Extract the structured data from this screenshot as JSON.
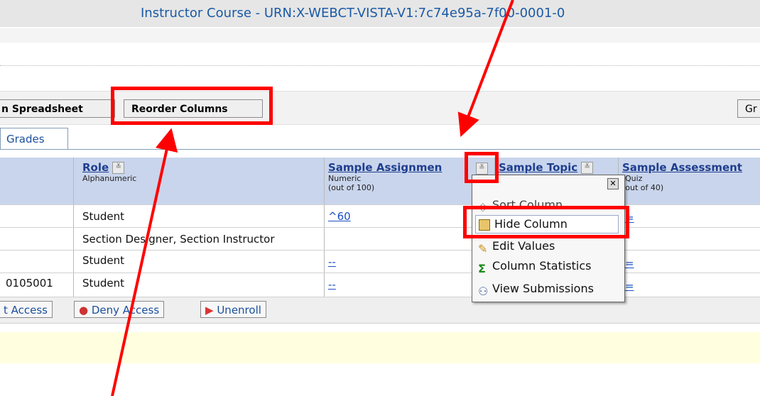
{
  "header": {
    "title": "Instructor Course - URN:X-WEBCT-VISTA-V1:7c74e95a-7f00-0001-0"
  },
  "toolbar": {
    "spreadsheet_label": "n Spreadsheet",
    "reorder_label": "Reorder Columns",
    "right_label": "Gr"
  },
  "tabs": {
    "grades_label": "Grades"
  },
  "grid": {
    "columns": {
      "role": {
        "label": "Role",
        "type": "Alphanumeric"
      },
      "assignment": {
        "label": "Sample Assignmen",
        "type": "Numeric",
        "out_of": "(out of 100)"
      },
      "topic": {
        "label": "Sample Topic"
      },
      "assessment": {
        "label": "Sample Assessment",
        "type": "Quiz",
        "out_of": "(out of 40)"
      }
    },
    "rows": [
      {
        "id": "",
        "role": "Student",
        "assignment": "^60"
      },
      {
        "id": "",
        "role": "Section Designer, Section Instructor",
        "assignment": ""
      },
      {
        "id": "",
        "role": "Student",
        "assignment": "--"
      },
      {
        "id": "0105001",
        "role": "Student",
        "assignment": "--"
      }
    ]
  },
  "context_menu": {
    "items": [
      "Sort Column",
      "Hide Column",
      "Edit Values",
      "Column Statistics",
      "View Submissions"
    ]
  },
  "bottom_actions": {
    "grant_label": "t Access",
    "deny_label": "Deny Access",
    "unenroll_label": "Unenroll"
  },
  "colors": {
    "annotation_red": "#ff0000",
    "header_blue": "#c9d5ec",
    "link_blue": "#1a4fc2"
  }
}
